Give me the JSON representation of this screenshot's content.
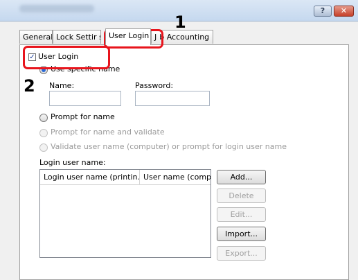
{
  "window": {
    "help_label": "?",
    "close_label": "✕"
  },
  "tabs": [
    {
      "label": "General"
    },
    {
      "label": "Lock Settir"
    },
    {
      "label": "s"
    },
    {
      "label": "User Login"
    },
    {
      "label": "J"
    },
    {
      "label": "b Accounting"
    }
  ],
  "user_login": {
    "label": "User Login",
    "checked": true
  },
  "options": {
    "use_specific_name": "Use specific name",
    "name_label": "Name:",
    "password_label": "Password:",
    "name_value": "",
    "password_value": "",
    "prompt_for_name": "Prompt for name",
    "prompt_and_validate": "Prompt for name and validate",
    "validate_or_prompt": "Validate user name (computer) or prompt for login user name"
  },
  "login_list": {
    "label": "Login user name:",
    "columns": [
      "Login user name (printin...",
      "User name (compu"
    ]
  },
  "buttons": {
    "add": "Add...",
    "delete": "Delete",
    "edit": "Edit...",
    "import": "Import...",
    "export": "Export..."
  },
  "annotations": {
    "step1": "1",
    "step2": "2"
  },
  "colors": {
    "callout": "#e8141c",
    "radio_selected": "#2a6ad6"
  }
}
